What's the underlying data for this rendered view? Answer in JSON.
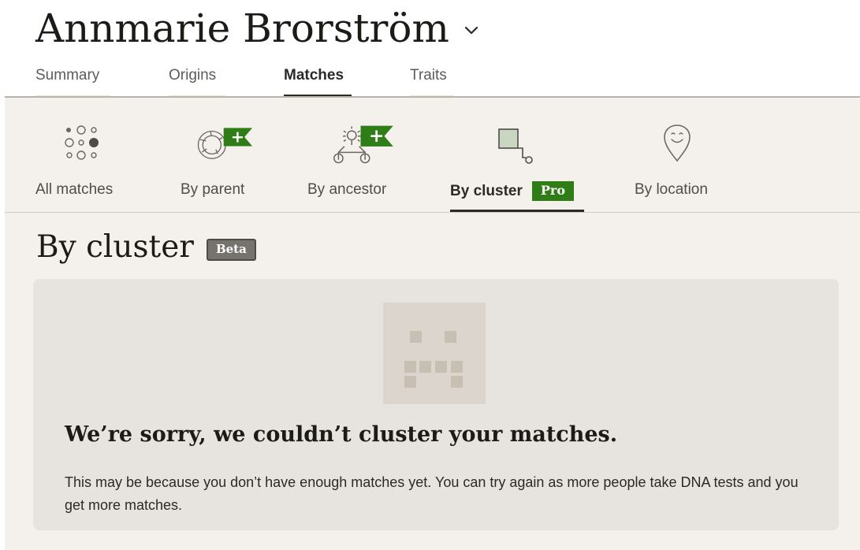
{
  "header": {
    "person_name": "Annmarie Brorström",
    "tabs": [
      {
        "label": "Summary"
      },
      {
        "label": "Origins"
      },
      {
        "label": "Matches",
        "active": true
      },
      {
        "label": "Traits"
      }
    ]
  },
  "match_views": [
    {
      "label": "All matches",
      "icon": "all-matches-dots-icon"
    },
    {
      "label": "By parent",
      "icon": "parent-circle-icon",
      "flag": "+",
      "flag_icon": "plus-flag-icon"
    },
    {
      "label": "By ancestor",
      "icon": "ancestor-tree-icon",
      "flag": "+",
      "flag_icon": "plus-flag-icon"
    },
    {
      "label": "By cluster",
      "icon": "cluster-icon",
      "badge": "Pro",
      "active": true
    },
    {
      "label": "By location",
      "icon": "location-pin-icon"
    }
  ],
  "section": {
    "title": "By cluster",
    "badge": "Beta"
  },
  "empty_state": {
    "illustration": "sad-face-placeholder-icon",
    "heading": "We’re sorry, we couldn’t cluster your matches.",
    "body": "This may be because you don’t have enough matches yet. You can try again as more people take DNA tests and you get more matches."
  },
  "colors": {
    "accent_green": "#2e7d16",
    "page_background": "#f4f1ed",
    "card_background": "#e7e3de",
    "beta_badge": "#76736d"
  }
}
